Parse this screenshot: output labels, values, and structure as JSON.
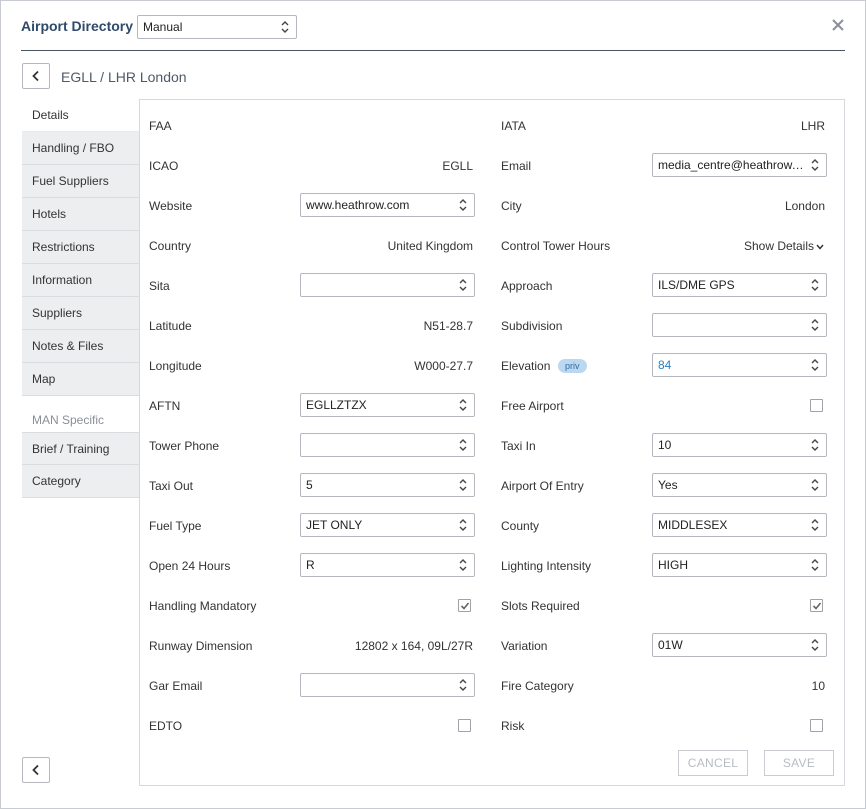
{
  "header": {
    "title": "Airport Directory",
    "mode_select": "Manual"
  },
  "breadcrumb": {
    "title": "EGLL / LHR London"
  },
  "sidebar": {
    "items": [
      "Details",
      "Handling / FBO",
      "Fuel Suppliers",
      "Hotels",
      "Restrictions",
      "Information",
      "Suppliers",
      "Notes & Files",
      "Map"
    ],
    "group_label": "MAN Specific",
    "group_items": [
      "Brief / Training",
      "Category"
    ]
  },
  "details": {
    "faa": {
      "label": "FAA",
      "value": ""
    },
    "iata": {
      "label": "IATA",
      "value": "LHR"
    },
    "icao": {
      "label": "ICAO",
      "value": "EGLL"
    },
    "email": {
      "label": "Email",
      "value": "media_centre@heathrow.com"
    },
    "website": {
      "label": "Website",
      "value": "www.heathrow.com"
    },
    "city": {
      "label": "City",
      "value": "London"
    },
    "country": {
      "label": "Country",
      "value": "United Kingdom"
    },
    "control_tower_hours": {
      "label": "Control Tower Hours",
      "value": "Show Details"
    },
    "sita": {
      "label": "Sita",
      "value": ""
    },
    "approach": {
      "label": "Approach",
      "value": "ILS/DME GPS"
    },
    "latitude": {
      "label": "Latitude",
      "value": "N51-28.7"
    },
    "subdivision": {
      "label": "Subdivision",
      "value": ""
    },
    "longitude": {
      "label": "Longitude",
      "value": "W000-27.7"
    },
    "elevation": {
      "label": "Elevation",
      "badge": "priv",
      "value": "84"
    },
    "aftn": {
      "label": "AFTN",
      "value": "EGLLZTZX"
    },
    "free_airport": {
      "label": "Free Airport",
      "checked": false
    },
    "tower_phone": {
      "label": "Tower Phone",
      "value": ""
    },
    "taxi_in": {
      "label": "Taxi In",
      "value": "10"
    },
    "taxi_out": {
      "label": "Taxi Out",
      "value": "5"
    },
    "airport_of_entry": {
      "label": "Airport Of Entry",
      "value": "Yes"
    },
    "fuel_type": {
      "label": "Fuel Type",
      "value": "JET ONLY"
    },
    "county": {
      "label": "County",
      "value": "MIDDLESEX"
    },
    "open_24_hours": {
      "label": "Open 24 Hours",
      "value": "R"
    },
    "lighting_intensity": {
      "label": "Lighting Intensity",
      "value": "HIGH"
    },
    "handling_mandatory": {
      "label": "Handling Mandatory",
      "checked": true
    },
    "slots_required": {
      "label": "Slots Required",
      "checked": true
    },
    "runway_dimension": {
      "label": "Runway Dimension",
      "value": "12802 x 164, 09L/27R"
    },
    "variation": {
      "label": "Variation",
      "value": "01W"
    },
    "gar_email": {
      "label": "Gar Email",
      "value": ""
    },
    "fire_category": {
      "label": "Fire Category",
      "value": "10"
    },
    "edto": {
      "label": "EDTO",
      "checked": false
    },
    "risk": {
      "label": "Risk",
      "checked": false
    }
  },
  "footer": {
    "cancel_label": "CANCEL",
    "save_label": "SAVE"
  },
  "colors": {
    "title": "#2f4a6a",
    "link_value": "#2f7dc4",
    "badge_bg": "#bcd8f1",
    "disabled_text": "#b8bcc1"
  }
}
